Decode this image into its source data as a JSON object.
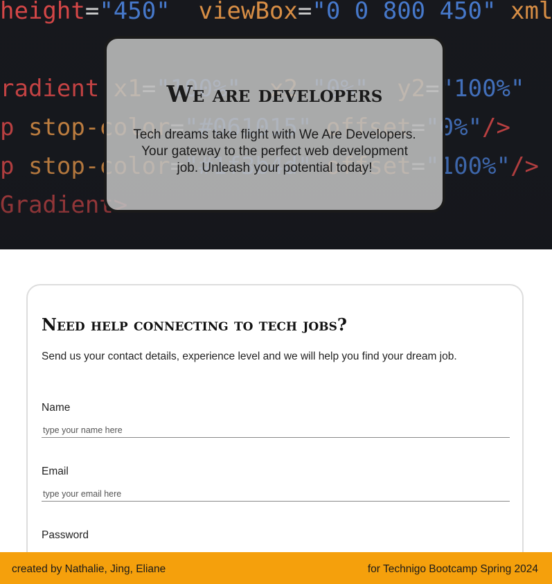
{
  "hero": {
    "code_lines": [
      {
        "parts": [
          {
            "t": "height",
            "c": "c-red"
          },
          {
            "t": "=",
            "c": "c-white"
          },
          {
            "t": "\"450\"",
            "c": "c-blue"
          },
          {
            "t": "  viewBox",
            "c": "c-orange"
          },
          {
            "t": "=",
            "c": "c-white"
          },
          {
            "t": "\"0 0 800 450\"",
            "c": "c-blue"
          },
          {
            "t": " xmlns",
            "c": "c-orange"
          }
        ]
      },
      {
        "parts": [
          {
            "t": "radient",
            "c": "c-red"
          },
          {
            "t": " x1",
            "c": "c-orange"
          },
          {
            "t": "=",
            "c": "c-white"
          },
          {
            "t": "\"100%\"",
            "c": "c-blue"
          },
          {
            "t": "  x2",
            "c": "c-orange"
          },
          {
            "t": " \"0%\"",
            "c": "c-blue"
          },
          {
            "t": "  y2",
            "c": "c-orange"
          },
          {
            "t": "=",
            "c": "c-white"
          },
          {
            "t": "\"100%\"",
            "c": "c-blue"
          }
        ]
      },
      {
        "parts": [
          {
            "t": "p",
            "c": "c-red"
          },
          {
            "t": " stop-color",
            "c": "c-orange"
          },
          {
            "t": "=",
            "c": "c-white"
          },
          {
            "t": "\"#061015\"",
            "c": "c-blue"
          },
          {
            "t": " offset",
            "c": "c-orange"
          },
          {
            "t": "=",
            "c": "c-white"
          },
          {
            "t": "\"0%\"",
            "c": "c-blue"
          },
          {
            "t": "/>",
            "c": "c-red"
          }
        ]
      },
      {
        "parts": [
          {
            "t": "p",
            "c": "c-red"
          },
          {
            "t": " stop-color",
            "c": "c-orange"
          },
          {
            "t": "=",
            "c": "c-white"
          },
          {
            "t": "\"#1f3b4d\"",
            "c": "c-blue"
          },
          {
            "t": " offset",
            "c": "c-orange"
          },
          {
            "t": "=",
            "c": "c-white"
          },
          {
            "t": "\"100%\"",
            "c": "c-blue"
          },
          {
            "t": "/>",
            "c": "c-red"
          }
        ]
      },
      {
        "parts": [
          {
            "t": "Gradient",
            "c": "c-red"
          },
          {
            "t": ">",
            "c": "c-red"
          }
        ]
      }
    ],
    "title": "We are developers",
    "text": "Tech dreams take flight with We Are Developers. Your gateway to the perfect web development job. Unleash your potential today!"
  },
  "form": {
    "title": "Need help connecting to tech jobs?",
    "description": "Send us your contact details, experience level and we will help you find your dream job.",
    "fields": [
      {
        "label": "Name",
        "placeholder": "type your name here"
      },
      {
        "label": "Email",
        "placeholder": "type your email here"
      },
      {
        "label": "Password",
        "placeholder": ""
      }
    ]
  },
  "footer": {
    "left": "created by Nathalie, Jing, Eliane",
    "right": "for Technigo Bootcamp Spring 2024"
  },
  "colors": {
    "footer_bg": "#f5a00c",
    "card_border": "#1a1a1a"
  }
}
